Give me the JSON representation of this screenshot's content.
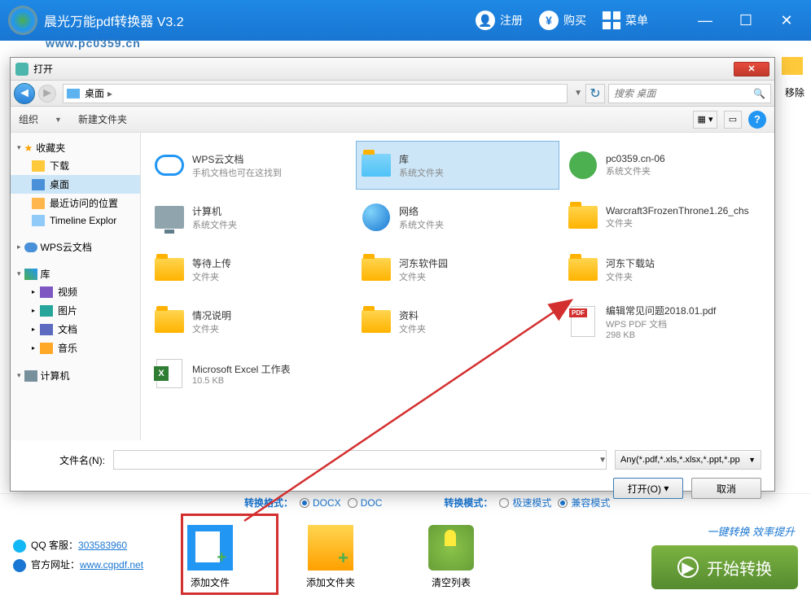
{
  "app": {
    "title": "晨光万能pdf转换器 V3.2",
    "watermark": "www.pc0359.cn",
    "titlebar": {
      "register": "注册",
      "buy": "购买",
      "menu": "菜单"
    }
  },
  "background": {
    "remove": "移除"
  },
  "dialog": {
    "title": "打开",
    "breadcrumb": "桌面",
    "search_placeholder": "搜索 桌面",
    "toolbar": {
      "organize": "组织",
      "new_folder": "新建文件夹"
    },
    "sidebar": {
      "favorites": "收藏夹",
      "downloads": "下载",
      "desktop": "桌面",
      "recent": "最近访问的位置",
      "timeline": "Timeline Explor",
      "wps_cloud": "WPS云文档",
      "library": "库",
      "video": "视频",
      "picture": "图片",
      "document": "文档",
      "music": "音乐",
      "computer": "计算机"
    },
    "files": [
      {
        "name": "WPS云文档",
        "sub": "手机文档也可在这找到",
        "type": "cloud"
      },
      {
        "name": "库",
        "sub": "系统文件夹",
        "type": "lib",
        "selected": true
      },
      {
        "name": "pc0359.cn-06",
        "sub": "系统文件夹",
        "type": "user"
      },
      {
        "name": "计算机",
        "sub": "系统文件夹",
        "type": "computer"
      },
      {
        "name": "网络",
        "sub": "系统文件夹",
        "type": "globe"
      },
      {
        "name": "Warcraft3FrozenThrone1.26_chs",
        "sub": "文件夹",
        "type": "folder"
      },
      {
        "name": "等待上传",
        "sub": "文件夹",
        "type": "folder"
      },
      {
        "name": "河东软件园",
        "sub": "文件夹",
        "type": "folder"
      },
      {
        "name": "河东下载站",
        "sub": "文件夹",
        "type": "folder"
      },
      {
        "name": "情况说明",
        "sub": "文件夹",
        "type": "folder"
      },
      {
        "name": "资料",
        "sub": "文件夹",
        "type": "folder"
      },
      {
        "name": "编辑常见问题2018.01.pdf",
        "sub": "WPS PDF 文档",
        "sub2": "298 KB",
        "type": "pdf"
      },
      {
        "name": "Microsoft Excel 工作表",
        "sub": "10.5 KB",
        "type": "excel"
      }
    ],
    "footer": {
      "filename_label": "文件名(N):",
      "filter": "Any(*.pdf,*.xls,*.xlsx,*.ppt,*.pp",
      "open_btn": "打开(O)",
      "cancel_btn": "取消"
    }
  },
  "bottom": {
    "format_label": "转换格式：",
    "docx": "DOCX",
    "doc": "DOC",
    "mode_label": "转换模式：",
    "fast_mode": "极速模式",
    "compat_mode": "兼容模式",
    "add_file": "添加文件",
    "add_folder": "添加文件夹",
    "clear_list": "清空列表",
    "start": "开始转换",
    "slogan": "一键转换  效率提升",
    "qq_label": "QQ 客服：",
    "qq_number": "303583960",
    "site_label": "官方网址：",
    "site_url": "www.cgpdf.net"
  }
}
